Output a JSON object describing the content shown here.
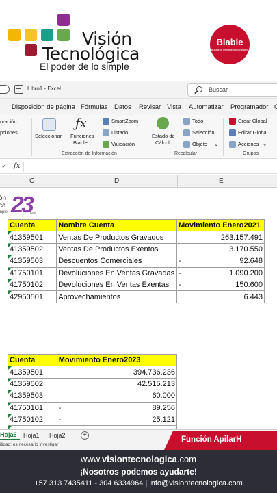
{
  "brand": {
    "name_line1": "Visión",
    "name_line2": "Tecnológica",
    "tagline": "El poder de lo simple",
    "partner": "Biable",
    "partner_sub": "Business Intelligence Available",
    "colors": {
      "purple": "#8e2e8f",
      "yellow": "#f2b705",
      "teal": "#1b9e8a",
      "green": "#6aa84f",
      "red": "#c8102e",
      "navy": "#2d2d36"
    }
  },
  "excel": {
    "doc_title": "Libro1 - Excel",
    "search_placeholder": "Buscar",
    "menu": [
      "r",
      "Disposición de página",
      "Fórmulas",
      "Datos",
      "Revisar",
      "Vista",
      "Automatizar",
      "Programador",
      "C"
    ],
    "ribbon": {
      "left_1": "uración",
      "left_2": "pciones",
      "seleccionar": "Seleccionar",
      "funciones_1": "Funciones",
      "funciones_2": "Biable",
      "smartzoom": "SmartZoom",
      "listado": "Listado",
      "validacion": "Validación",
      "group_info": "Extracción de Información",
      "estado_1": "Estado de",
      "estado_2": "Cálculo",
      "todo": "Todo",
      "seleccion": "Selección",
      "objeto": "Objeto",
      "group_recalc": "Recalcular",
      "crear_global": "Crear Global",
      "editar_global": "Editar Global",
      "acciones": "Acciones",
      "group_grupos": "Grupos"
    },
    "formula_label": "fx",
    "columns": [
      "C",
      "D",
      "E"
    ],
    "anniversary": {
      "t1": "ón",
      "t2": "ca",
      "t3": "mple",
      "number": "23",
      "anos": "Años"
    },
    "table1": {
      "headers": [
        "Cuenta",
        "Nombre Cuenta",
        "Movimiento Enero2021"
      ],
      "rows": [
        {
          "cuenta": "41359501",
          "nombre": "Ventas De Productos Gravados",
          "neg": "",
          "valor": "263.157.491"
        },
        {
          "cuenta": "41359502",
          "nombre": "Ventas De Productos Exentos",
          "neg": "",
          "valor": "3.170.550"
        },
        {
          "cuenta": "41359503",
          "nombre": "Descuentos Comerciales",
          "neg": "-",
          "valor": "92.648"
        },
        {
          "cuenta": "41750101",
          "nombre": "Devoluciones En Ventas Gravadas",
          "neg": "-",
          "valor": "1.090.200"
        },
        {
          "cuenta": "41750102",
          "nombre": "Devoluciones En Ventas Exentas",
          "neg": "-",
          "valor": "150.600"
        },
        {
          "cuenta": "42950501",
          "nombre": "Aprovechamientos",
          "neg": "",
          "valor": "6.443"
        }
      ]
    },
    "table2": {
      "headers": [
        "Cuenta",
        "Movimiento Enero2023"
      ],
      "rows": [
        {
          "cuenta": "41359501",
          "neg": "",
          "valor": "394.736.236"
        },
        {
          "cuenta": "41359502",
          "neg": "",
          "valor": "42.515.213"
        },
        {
          "cuenta": "41359503",
          "neg": "",
          "valor": "60.000"
        },
        {
          "cuenta": "41750101",
          "neg": "-",
          "valor": "89.256"
        },
        {
          "cuenta": "41750102",
          "neg": "-",
          "valor": "25.121"
        },
        {
          "cuenta": "42950501",
          "neg": "",
          "valor": "4.000"
        }
      ]
    },
    "sheet_tabs": [
      "Hoja6",
      "Hoja1",
      "Hoja2"
    ],
    "status_text": "ilidad: es necesario investigar"
  },
  "banner": {
    "function_name": "Función ApilarH"
  },
  "footer": {
    "site_prefix": "www.",
    "site_bold": "visiontecnologica",
    "site_suffix": ".com",
    "slogan": "¡Nosotros podemos ayudarte!",
    "contact": "+57 313 7435411 - 304 6334964  |  info@visiontecnologica.com"
  }
}
